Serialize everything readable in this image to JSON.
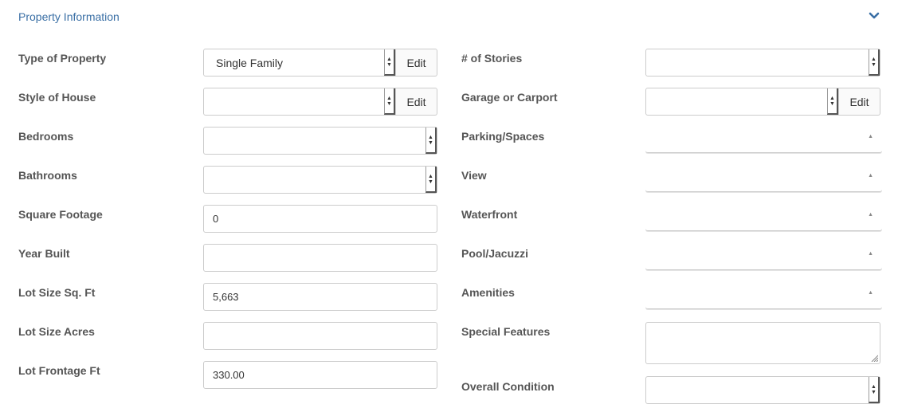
{
  "section": {
    "title": "Property Information"
  },
  "left": {
    "type_of_property": {
      "label": "Type of Property",
      "value": "Single Family",
      "edit_label": "Edit"
    },
    "style_of_house": {
      "label": "Style of House",
      "value": "",
      "edit_label": "Edit"
    },
    "bedrooms": {
      "label": "Bedrooms",
      "value": ""
    },
    "bathrooms": {
      "label": "Bathrooms",
      "value": ""
    },
    "square_footage": {
      "label": "Square Footage",
      "value": "0"
    },
    "year_built": {
      "label": "Year Built",
      "value": ""
    },
    "lot_size_sqft": {
      "label": "Lot Size Sq. Ft",
      "value": "5,663"
    },
    "lot_size_acres": {
      "label": "Lot Size Acres",
      "value": ""
    },
    "lot_frontage": {
      "label": "Lot Frontage Ft",
      "value": "330.00"
    }
  },
  "right": {
    "stories": {
      "label": "# of Stories",
      "value": ""
    },
    "garage": {
      "label": "Garage or Carport",
      "value": "",
      "edit_label": "Edit"
    },
    "parking": {
      "label": "Parking/Spaces"
    },
    "view": {
      "label": "View"
    },
    "waterfront": {
      "label": "Waterfront"
    },
    "pool": {
      "label": "Pool/Jacuzzi"
    },
    "amenities": {
      "label": "Amenities"
    },
    "special_features": {
      "label": "Special Features",
      "value": ""
    },
    "overall_condition": {
      "label": "Overall Condition",
      "value": ""
    }
  },
  "icons": {
    "collapse": "chevron-down-icon",
    "select_arrow": "select-arrow-icon",
    "multiselect_caret": "caret-up-icon",
    "resize": "resize-handle-icon"
  },
  "colors": {
    "accent": "#3a6fa5",
    "label": "#555555",
    "border": "#cccccc"
  }
}
